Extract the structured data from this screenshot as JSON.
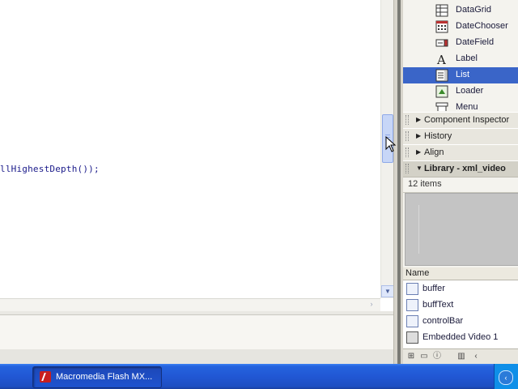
{
  "editor": {
    "code_line": "llHighestDepth());"
  },
  "components": {
    "items": [
      {
        "label": "DataGrid",
        "icon": "datagrid-icon"
      },
      {
        "label": "DateChooser",
        "icon": "datechooser-icon"
      },
      {
        "label": "DateField",
        "icon": "datefield-icon"
      },
      {
        "label": "Label",
        "icon": "label-icon"
      },
      {
        "label": "List",
        "icon": "list-icon",
        "selected": true
      },
      {
        "label": "Loader",
        "icon": "loader-icon"
      },
      {
        "label": "Menu",
        "icon": "menu-icon"
      }
    ]
  },
  "panels": {
    "component_inspector": "Component Inspector",
    "history": "History",
    "align": "Align",
    "library": "Library - xml_video"
  },
  "library": {
    "count": "12 items",
    "column_name": "Name",
    "items": [
      {
        "label": "buffer"
      },
      {
        "label": "buffText"
      },
      {
        "label": "controlBar"
      },
      {
        "label": "Embedded Video 1"
      }
    ]
  },
  "taskbar": {
    "app_button": "Macromedia Flash MX..."
  },
  "colors": {
    "selection": "#3a65c8",
    "taskbar": "#2157d4"
  }
}
